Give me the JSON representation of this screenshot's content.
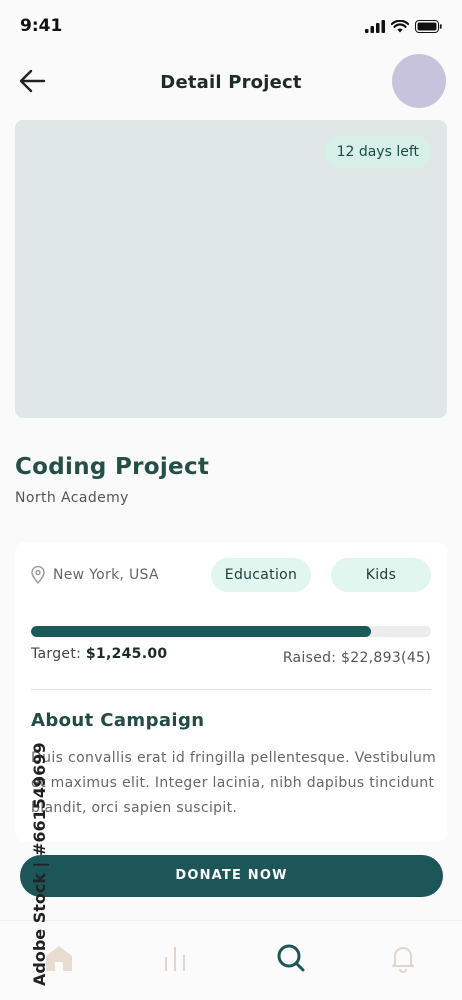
{
  "status_bar": {
    "time": "9:41"
  },
  "header": {
    "title": "Detail Project"
  },
  "project": {
    "days_left": "12 days left",
    "title": "Coding Project",
    "organization": "North Academy"
  },
  "info": {
    "location": "New York, USA",
    "tags": [
      "Education",
      "Kids"
    ],
    "progress_percent": 85,
    "target_label": "Target: ",
    "target_value": "$1,245.00",
    "raised": "Raised: $22,893(45)"
  },
  "about": {
    "title": "About Campaign",
    "text": "Duis convallis erat id fringilla pellentesque. Vestibulum et maximus elit. Integer lacinia, nibh dapibus tincidunt blandit, orci sapien suscipit."
  },
  "donate": {
    "label": "DONATE NOW"
  },
  "bottom_nav": {
    "items": [
      "home-icon",
      "stats-icon",
      "search-icon",
      "bell-icon"
    ],
    "active": "search-icon"
  },
  "watermark": {
    "text": "Adobe Stock | #661549699"
  },
  "colors": {
    "accent": "#1c5659",
    "tag_bg": "#e1f6ef",
    "image_placeholder": "#dfe8e6",
    "avatar": "#c8c3dc"
  }
}
